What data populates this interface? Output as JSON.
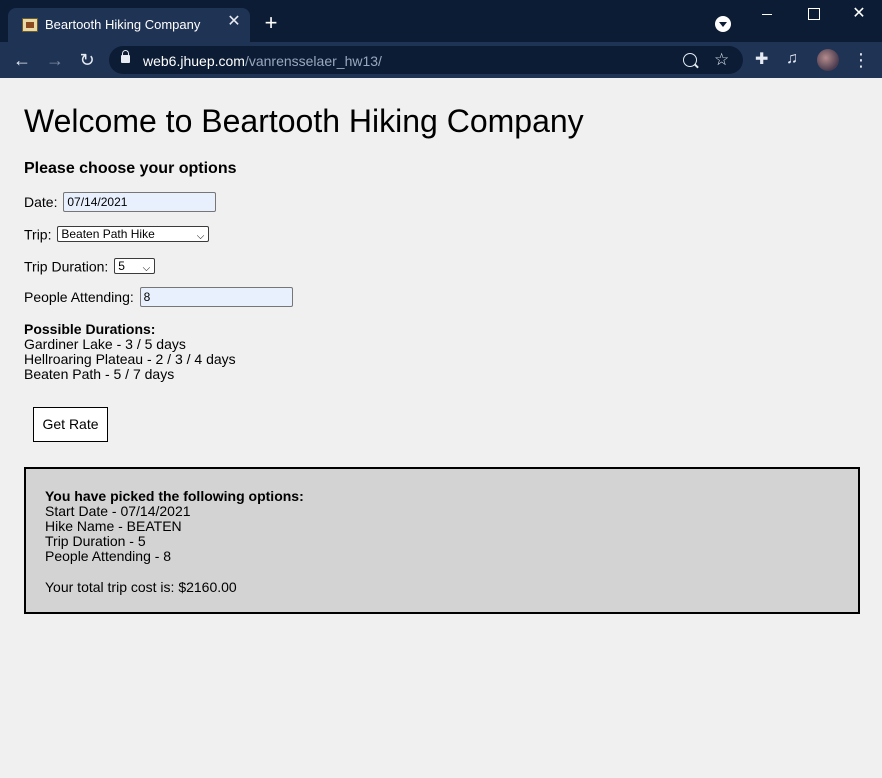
{
  "browser": {
    "tab_title": "Beartooth Hiking Company",
    "url_host": "web6.jhuep.com",
    "url_path": "/vanrensselaer_hw13/"
  },
  "page": {
    "heading": "Welcome to Beartooth Hiking Company",
    "subheading": "Please choose your options",
    "date_label": "Date:",
    "date_value": "07/14/2021",
    "trip_label": "Trip:",
    "trip_value": "Beaten Path Hike",
    "duration_label": "Trip Duration:",
    "duration_value": "5",
    "people_label": "People Attending:",
    "people_value": "8",
    "durations": {
      "title": "Possible Durations:",
      "lines": [
        "Gardiner Lake - 3 / 5 days",
        "Hellroaring Plateau - 2 / 3 / 4 days",
        "Beaten Path - 5 / 7 days"
      ]
    },
    "rate_button": "Get Rate",
    "result": {
      "title": "You have picked the following options:",
      "lines": [
        "Start Date - 07/14/2021",
        "Hike Name - BEATEN",
        "Trip Duration - 5",
        "People Attending - 8"
      ],
      "total": "Your total trip cost is: $2160.00"
    }
  }
}
